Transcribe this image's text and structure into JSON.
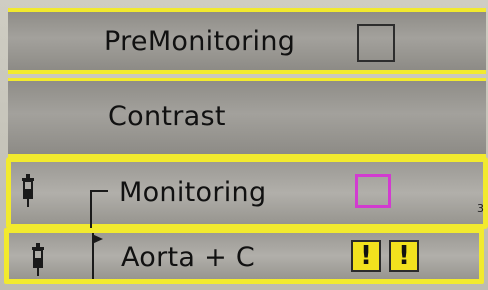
{
  "rows": [
    {
      "label": "PreMonitoring",
      "checked": false
    },
    {
      "label": "Contrast"
    },
    {
      "label": "Monitoring",
      "checked": false,
      "highlight_color": "#d23bd0",
      "edge_mark": "3"
    },
    {
      "label": "Aorta + C",
      "warnings": [
        "!",
        "!"
      ]
    }
  ],
  "colors": {
    "frame": "#f2ea2e",
    "panel": "#9e9c97",
    "warning": "#f2e21e"
  },
  "icons": [
    "syringe-icon",
    "syringe-icon",
    "bracket-icon",
    "flag-marker-icon"
  ]
}
